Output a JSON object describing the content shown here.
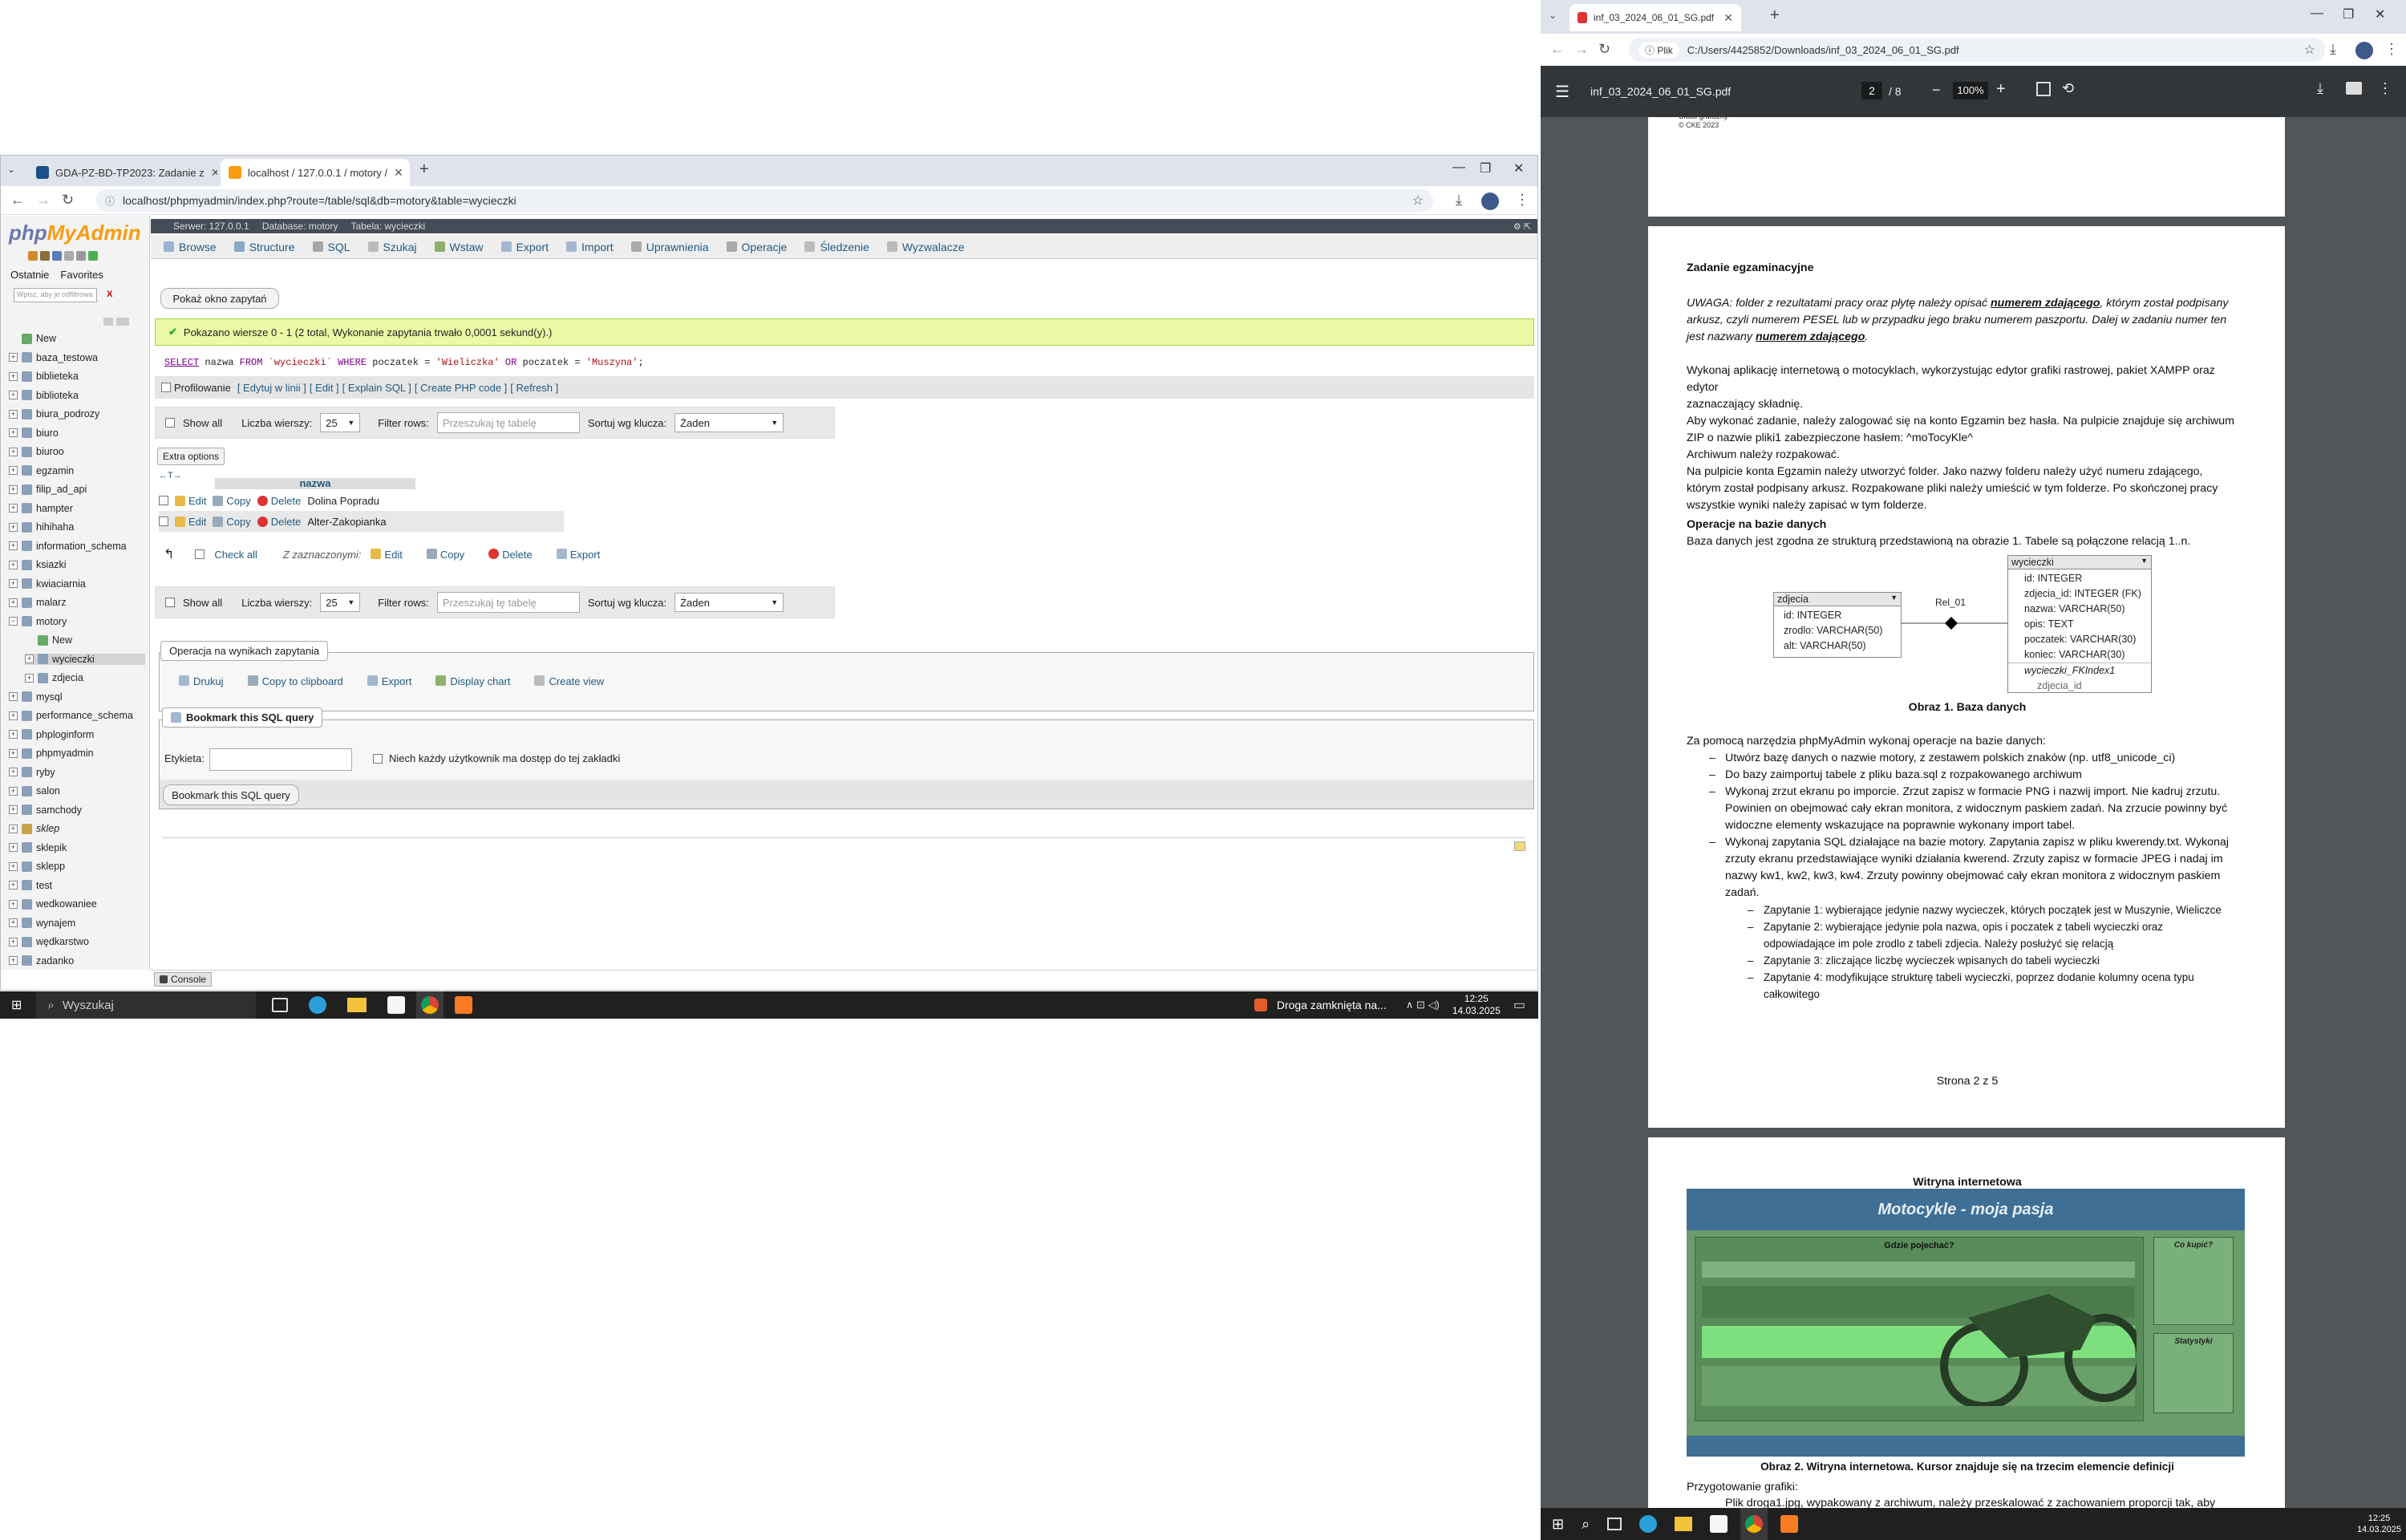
{
  "left_browser": {
    "tabs": [
      {
        "label": "GDA-PZ-BD-TP2023: Zadanie z"
      },
      {
        "label": "localhost / 127.0.0.1 / motory /"
      }
    ],
    "new_tab": "+",
    "url": "localhost/phpmyadmin/index.php?route=/table/sql&db=motory&table=wycieczki"
  },
  "pma": {
    "logo_php": "php",
    "logo_my": "MyAdmin",
    "sidebar_tabs": [
      "Ostatnie",
      "Favorites"
    ],
    "filter_placeholder": "Wpisz, aby je odfiltrowa",
    "filter_clear": "X",
    "databases": [
      {
        "name": "New"
      },
      {
        "name": "baza_testowa"
      },
      {
        "name": "biblieteka"
      },
      {
        "name": "biblioteka"
      },
      {
        "name": "biura_podrozy"
      },
      {
        "name": "biuro"
      },
      {
        "name": "biuroo"
      },
      {
        "name": "egzamin"
      },
      {
        "name": "filip_ad_api"
      },
      {
        "name": "hampter"
      },
      {
        "name": "hihihaha"
      },
      {
        "name": "information_schema"
      },
      {
        "name": "ksiazki"
      },
      {
        "name": "kwiaciarnia"
      },
      {
        "name": "malarz"
      },
      {
        "name": "motory"
      },
      {
        "name": "New"
      },
      {
        "name": "wycieczki"
      },
      {
        "name": "zdjecia"
      },
      {
        "name": "mysql"
      },
      {
        "name": "performance_schema"
      },
      {
        "name": "phploginform"
      },
      {
        "name": "phpmyadmin"
      },
      {
        "name": "ryby"
      },
      {
        "name": "salon"
      },
      {
        "name": "samchody"
      },
      {
        "name": "sklep"
      },
      {
        "name": "sklepik"
      },
      {
        "name": "sklepp"
      },
      {
        "name": "test"
      },
      {
        "name": "wedkowaniee"
      },
      {
        "name": "wynajem"
      },
      {
        "name": "wędkarstwo"
      },
      {
        "name": "zadanko"
      }
    ],
    "breadcrumb": [
      "Serwer: 127.0.0.1",
      "Database: motory",
      "Tabela: wycieczki"
    ],
    "menu": [
      "Browse",
      "Structure",
      "SQL",
      "Szukaj",
      "Wstaw",
      "Export",
      "Import",
      "Uprawnienia",
      "Operacje",
      "Śledzenie",
      "Wyzwalacze"
    ],
    "show_query_btn": "Pokaż okno zapytań",
    "success_msg": "Pokazano wiersze 0 - 1 (2 total, Wykonanie zapytania trwało 0,0001 sekund(y).)",
    "sql": {
      "select": "SELECT",
      "col": " nazwa ",
      "from": "FROM",
      "table": " `wycieczki` ",
      "where": "WHERE",
      "cond1": " poczatek = ",
      "val1": "'Wieliczka'",
      "or": " OR ",
      "cond2": "poczatek = ",
      "val2": "'Muszyna'",
      "end": ";"
    },
    "sql_links": {
      "profiling": "Profilowanie",
      "links": [
        "[ Edytuj w linii ]",
        "[ Edit ]",
        "[ Explain SQL ]",
        "[ Create PHP code ]",
        "[ Refresh ]"
      ]
    },
    "nav": {
      "show_all": "Show all",
      "rows_label": "Liczba wierszy:",
      "rows_value": "25",
      "filter_label": "Filter rows:",
      "filter_placeholder": "Przeszukaj tę tabelę",
      "sort_label": "Sortuj wg klucza:",
      "sort_value": "Żaden"
    },
    "extra_options": "Extra options",
    "column_header": "nazwa",
    "col_arrows": "←T→",
    "rows": [
      {
        "edit": "Edit",
        "copy": "Copy",
        "delete": "Delete",
        "value": "Dolina Popradu"
      },
      {
        "edit": "Edit",
        "copy": "Copy",
        "delete": "Delete",
        "value": "Alter-Zakopianka"
      }
    ],
    "bulk": {
      "check_all": "Check all",
      "with_selected": "Z zaznaczonymi:",
      "edit": "Edit",
      "copy": "Copy",
      "delete": "Delete",
      "export": "Export"
    },
    "ops": {
      "legend": "Operacja na wynikach zapytania",
      "items": [
        "Drukuj",
        "Copy to clipboard",
        "Export",
        "Display chart",
        "Create view"
      ]
    },
    "bookmark": {
      "legend": "Bookmark this SQL query",
      "label": "Etykieta:",
      "checkbox_label": "Niech każdy użytkownik ma dostęp do tej zakładki",
      "button": "Bookmark this SQL query"
    },
    "console": "Console"
  },
  "left_taskbar": {
    "search": "Wyszukaj",
    "notification": "Droga zamknięta na...",
    "time": "12:25",
    "date": "14.03.2025"
  },
  "right_browser": {
    "tab": "inf_03_2024_06_01_SG.pdf",
    "new_tab": "+",
    "file_label": "Plik",
    "url": "C:/Users/4425852/Downloads/inf_03_2024_06_01_SG.pdf",
    "pdf_title": "inf_03_2024_06_01_SG.pdf",
    "page_current": "2",
    "page_total": "/ 8",
    "zoom": "100%"
  },
  "pdf": {
    "prev_footer1": "Układ graficzny",
    "prev_footer2": "© CKE 2023",
    "heading": "Zadanie egzaminacyjne",
    "uwaga_1": "UWAGA: folder z rezultatami pracy oraz płytę należy opisać ",
    "uwaga_1b": "numerem zdającego",
    "uwaga_1c": ", którym został podpisany",
    "uwaga_2": "arkusz, czyli numerem PESEL lub w przypadku jego braku numerem paszportu. Dalej w zadaniu numer ten",
    "uwaga_3": "jest nazwany ",
    "uwaga_3b": "numerem zdającego",
    "uwaga_3c": ".",
    "intro": [
      "Wykonaj aplikację internetową o motocyklach, wykorzystując edytor grafiki rastrowej, pakiet XAMPP oraz edytor",
      "zaznaczający składnię.",
      "Aby wykonać zadanie, należy zalogować się na konto Egzamin bez hasła. Na pulpicie znajduje się archiwum",
      "ZIP o nazwie pliki1 zabezpieczone hasłem: ^moTocyKle^",
      "Archiwum należy rozpakować.",
      "Na pulpicie konta Egzamin należy utworzyć folder. Jako nazwy folderu należy użyć numeru zdającego,",
      "którym został podpisany arkusz. Rozpakowane pliki należy umieścić w tym folderze. Po skończonej pracy",
      "wszystkie wyniki należy zapisać w tym folderze."
    ],
    "db_heading": "Operacje na bazie danych",
    "db_intro": "Baza danych jest zgodna ze strukturą przedstawioną na obrazie 1. Tabele są połączone relacją 1..n.",
    "diagram": {
      "t1_name": "zdjecia",
      "t1_fields": [
        "id: INTEGER",
        "zrodlo: VARCHAR(50)",
        "alt: VARCHAR(50)"
      ],
      "rel": "Rel_01",
      "t2_name": "wycieczki",
      "t2_fields": [
        "id: INTEGER",
        "zdjecia_id: INTEGER (FK)",
        "nazwa: VARCHAR(50)",
        "opis: TEXT",
        "poczatek: VARCHAR(30)",
        "koniec: VARCHAR(30)"
      ],
      "t2_index": "wycieczki_FKIndex1",
      "t2_index_field": "zdjecia_id"
    },
    "caption1": "Obraz 1. Baza danych",
    "ops_intro": "Za pomocą narzędzia phpMyAdmin wykonaj operacje na bazie danych:",
    "ops": [
      "Utwórz bazę danych o nazwie motory, z zestawem polskich znaków (np. utf8_unicode_ci)",
      "Do bazy zaimportuj tabele z pliku baza.sql z rozpakowanego archiwum",
      "Wykonaj zrzut ekranu po imporcie. Zrzut zapisz w formacie PNG i nazwij import. Nie kadruj zrzutu.",
      "Powinien on obejmować cały ekran monitora, z widocznym paskiem zadań. Na zrzucie powinny być",
      "widoczne elementy wskazujące na poprawnie wykonany import tabel.",
      "Wykonaj zapytania SQL działające na bazie motory. Zapytania zapisz w pliku kwerendy.txt. Wykonaj",
      "zrzuty ekranu przedstawiające wyniki działania kwerend. Zrzuty zapisz w formacie JPEG i nadaj im",
      "nazwy kw1, kw2, kw3, kw4. Zrzuty powinny obejmować cały ekran monitora z widocznym paskiem",
      "zadań."
    ],
    "queries": [
      "Zapytanie 1: wybierające jedynie nazwy wycieczek, których początek jest w Muszynie, Wieliczce",
      "Zapytanie 2: wybierające jedynie pola nazwa, opis i poczatek z tabeli wycieczki oraz",
      "odpowiadające im pole zrodlo z tabeli zdjecia. Należy posłużyć się relacją",
      "Zapytanie 3: zliczające liczbę wycieczek wpisanych do tabeli wycieczki",
      "Zapytanie 4: modyfikujące strukturę tabeli wycieczki, poprzez dodanie kolumny ocena typu",
      "całkowitego"
    ],
    "page_footer": "Strona 2 z 5",
    "site_heading": "Witryna internetowa",
    "banner": "Motocykle - moja pasja",
    "mock_where": "Gdzie pojechać?",
    "mock_what": "Co kupić?",
    "mock_stats": "Statystyki",
    "caption2": "Obraz 2. Witryna internetowa. Kursor znajduje się na trzecim elemencie definicji",
    "prep": "Przygotowanie grafiki:",
    "prep2": "Plik droga1.jpg, wypakowany z archiwum, należy przeskalować z zachowaniem proporcji tak, aby"
  },
  "right_taskbar": {
    "time": "12:25",
    "date": "14.03.2025"
  }
}
